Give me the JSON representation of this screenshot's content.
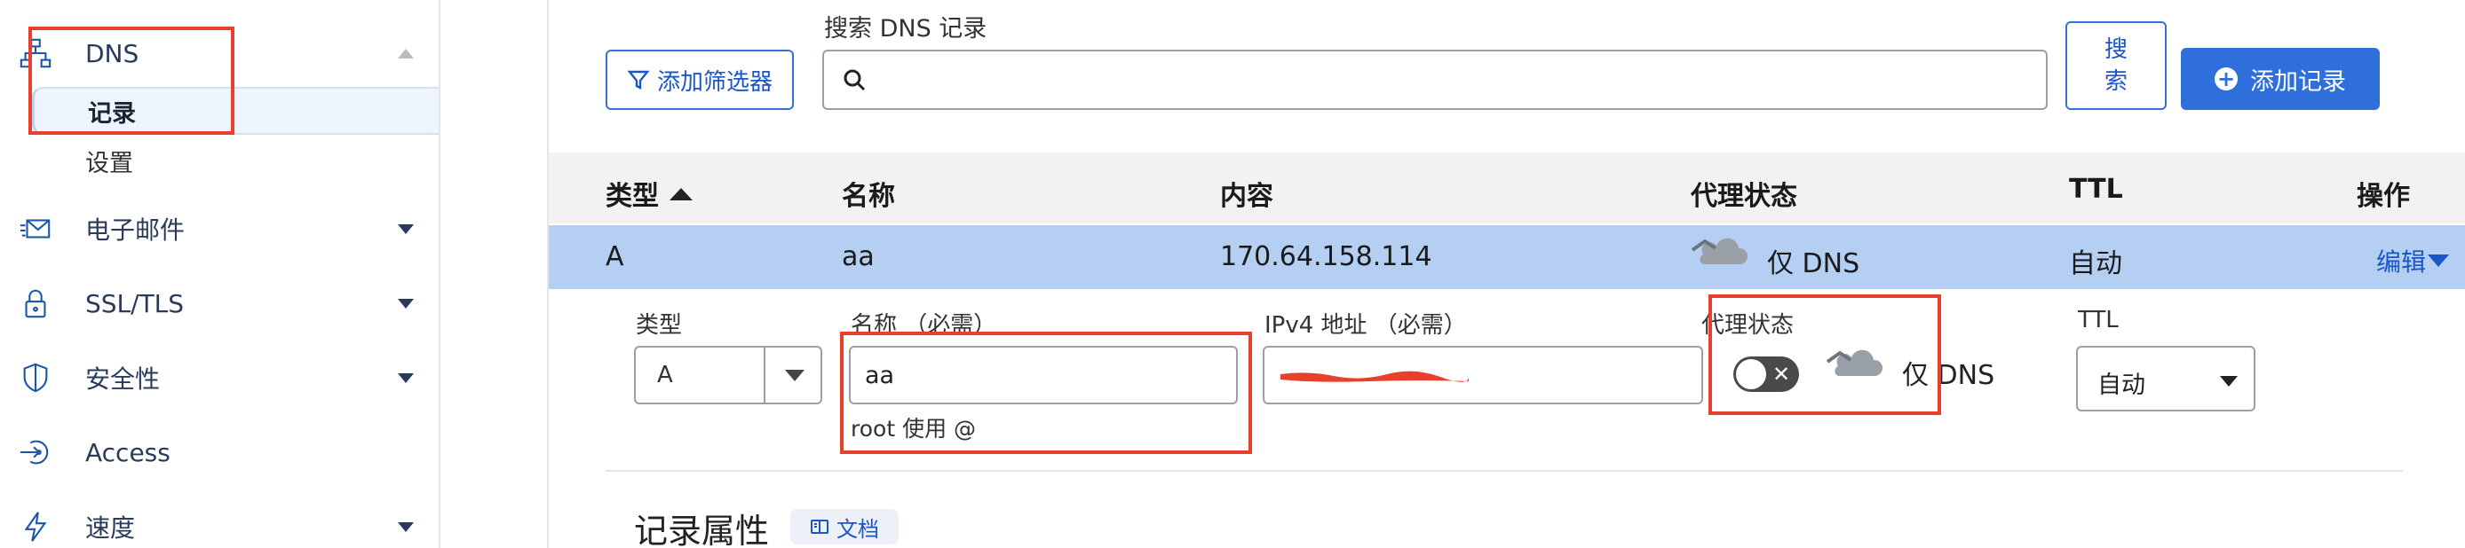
{
  "sidebar": {
    "dns": {
      "label": "DNS",
      "icon": "network-icon"
    },
    "dns_sub": [
      {
        "label": "记录",
        "active": true
      },
      {
        "label": "设置",
        "active": false
      }
    ],
    "items": [
      {
        "label": "电子邮件",
        "icon": "email-icon",
        "has_caret": true
      },
      {
        "label": "SSL/TLS",
        "icon": "lock-icon",
        "has_caret": true
      },
      {
        "label": "安全性",
        "icon": "shield-icon",
        "has_caret": true
      },
      {
        "label": "Access",
        "icon": "access-icon",
        "has_caret": false
      },
      {
        "label": "速度",
        "icon": "bolt-icon",
        "has_caret": true
      }
    ]
  },
  "toolbar": {
    "filter_label": "添加筛选器",
    "search_label": "搜索 DNS 记录",
    "search_placeholder": "",
    "search_btn_line1": "搜",
    "search_btn_line2": "索",
    "add_label": "添加记录"
  },
  "table": {
    "headers": {
      "type": "类型",
      "name": "名称",
      "content": "内容",
      "proxy": "代理状态",
      "ttl": "TTL",
      "actions": "操作"
    },
    "sort": "ascending",
    "row": {
      "type": "A",
      "name": "aa",
      "content": "170.64.158.114",
      "proxy": "仅 DNS",
      "ttl": "自动",
      "edit": "编辑"
    }
  },
  "form": {
    "type_label": "类型",
    "type_value": "A",
    "name_label": "名称 （必需）",
    "name_value": "aa",
    "name_hint": "root 使用 @",
    "ipv4_label": "IPv4 地址 （必需）",
    "ipv4_value_redacted": true,
    "proxy_label": "代理状态",
    "proxy_toggle_on": false,
    "proxy_value": "仅 DNS",
    "ttl_label": "TTL",
    "ttl_value": "自动"
  },
  "section": {
    "title": "记录属性",
    "doc_label": "文档"
  },
  "colors": {
    "accent": "#2f6fdb",
    "highlight_row": "#b5cff3",
    "annotation": "#e8402d"
  }
}
